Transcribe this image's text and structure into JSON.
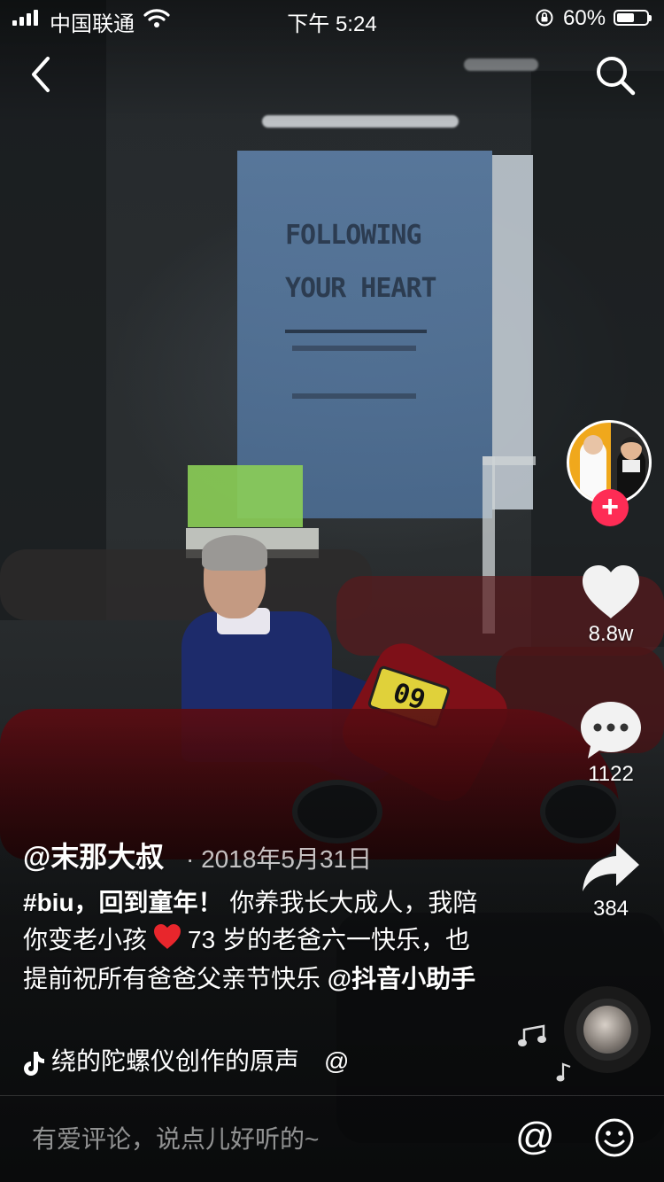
{
  "status_bar": {
    "carrier": "中国联通",
    "time": "下午 5:24",
    "battery_percent_text": "60%",
    "battery_level": 0.6,
    "signal_bars": 4
  },
  "nav": {
    "back_icon": "chevron-left-icon",
    "search_icon": "search-icon"
  },
  "video_scene": {
    "banner_line1": "FOLLOWING",
    "banner_line2": "YOUR HEART",
    "kart_number": "09"
  },
  "actions": {
    "follow_label": "+",
    "likes": "8.8w",
    "comments": "1122",
    "shares": "384"
  },
  "post": {
    "author": "@末那大叔",
    "date": "· 2018年5月31日",
    "hashtag": "#biu，回到童年！",
    "caption_part1": "你养我长大成人，我陪你变老小孩",
    "caption_part2": "73 岁的老爸六一快乐，也提前祝所有爸爸父亲节快乐",
    "mention": "@抖音小助手",
    "music": "绕的陀螺仪创作的原声　@"
  },
  "comment_bar": {
    "placeholder": "有爱评论，说点儿好听的~",
    "at_label": "@"
  },
  "colors": {
    "follow_red": "#fe2c55",
    "heart_white": "#ffffff"
  }
}
